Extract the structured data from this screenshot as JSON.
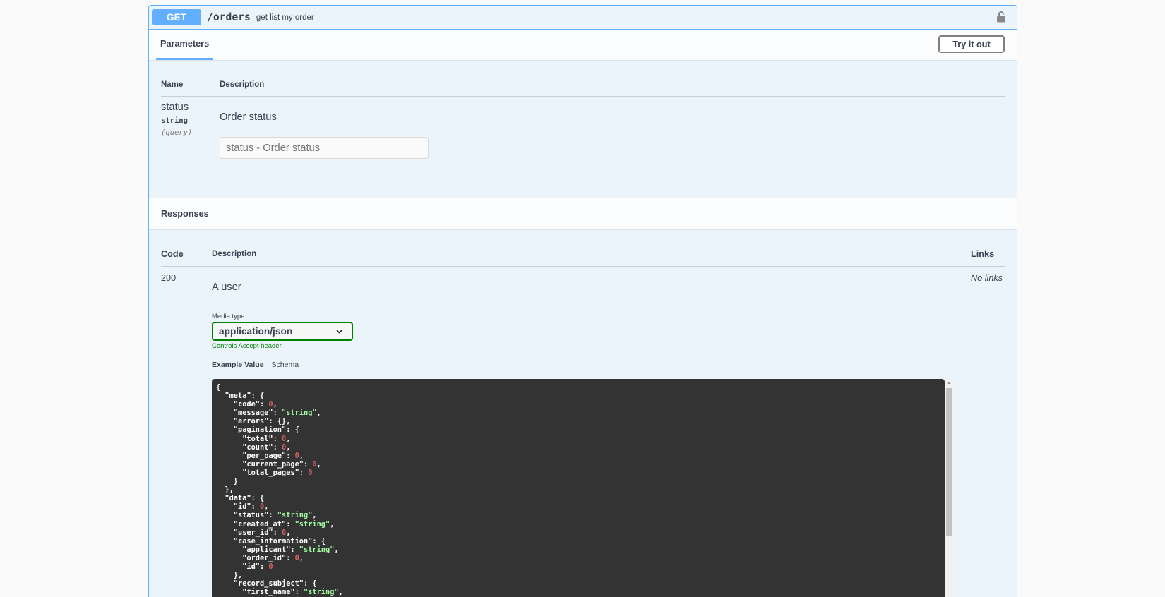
{
  "operation": {
    "method": "GET",
    "path": "/orders",
    "summary": "get list my order",
    "lock_icon": "unlocked-padlock-icon"
  },
  "parameters": {
    "tab_label": "Parameters",
    "try_label": "Try it out",
    "headers": {
      "name": "Name",
      "description": "Description"
    },
    "items": [
      {
        "name": "status",
        "type": "string",
        "in": "(query)",
        "description": "Order status",
        "placeholder": "status - Order status"
      }
    ]
  },
  "responses": {
    "title": "Responses",
    "headers": {
      "code": "Code",
      "description": "Description",
      "links": "Links"
    },
    "items": [
      {
        "code": "200",
        "description": "A user",
        "links": "No links",
        "media_type_label": "Media type",
        "media_type": "application/json",
        "controls_note": "Controls Accept header.",
        "example_tab": "Example Value",
        "schema_tab": "Schema"
      }
    ]
  },
  "example_lines": [
    [
      [
        "k",
        "{"
      ]
    ],
    [
      [
        "k",
        "  \"meta\": {"
      ]
    ],
    [
      [
        "k",
        "    \"code\": "
      ],
      [
        "n",
        "0"
      ],
      [
        "k",
        ","
      ]
    ],
    [
      [
        "k",
        "    \"message\": "
      ],
      [
        "s",
        "\"string\""
      ],
      [
        "k",
        ","
      ]
    ],
    [
      [
        "k",
        "    \"errors\": {},"
      ]
    ],
    [
      [
        "k",
        "    \"pagination\": {"
      ]
    ],
    [
      [
        "k",
        "      \"total\": "
      ],
      [
        "n",
        "0"
      ],
      [
        "k",
        ","
      ]
    ],
    [
      [
        "k",
        "      \"count\": "
      ],
      [
        "n",
        "0"
      ],
      [
        "k",
        ","
      ]
    ],
    [
      [
        "k",
        "      \"per_page\": "
      ],
      [
        "n",
        "0"
      ],
      [
        "k",
        ","
      ]
    ],
    [
      [
        "k",
        "      \"current_page\": "
      ],
      [
        "n",
        "0"
      ],
      [
        "k",
        ","
      ]
    ],
    [
      [
        "k",
        "      \"total_pages\": "
      ],
      [
        "n",
        "0"
      ]
    ],
    [
      [
        "k",
        "    }"
      ]
    ],
    [
      [
        "k",
        "  },"
      ]
    ],
    [
      [
        "k",
        "  \"data\": {"
      ]
    ],
    [
      [
        "k",
        "    \"id\": "
      ],
      [
        "n",
        "0"
      ],
      [
        "k",
        ","
      ]
    ],
    [
      [
        "k",
        "    \"status\": "
      ],
      [
        "s",
        "\"string\""
      ],
      [
        "k",
        ","
      ]
    ],
    [
      [
        "k",
        "    \"created_at\": "
      ],
      [
        "s",
        "\"string\""
      ],
      [
        "k",
        ","
      ]
    ],
    [
      [
        "k",
        "    \"user_id\": "
      ],
      [
        "n",
        "0"
      ],
      [
        "k",
        ","
      ]
    ],
    [
      [
        "k",
        "    \"case_information\": {"
      ]
    ],
    [
      [
        "k",
        "      \"applicant\": "
      ],
      [
        "s",
        "\"string\""
      ],
      [
        "k",
        ","
      ]
    ],
    [
      [
        "k",
        "      \"order_id\": "
      ],
      [
        "n",
        "0"
      ],
      [
        "k",
        ","
      ]
    ],
    [
      [
        "k",
        "      \"id\": "
      ],
      [
        "n",
        "0"
      ]
    ],
    [
      [
        "k",
        "    },"
      ]
    ],
    [
      [
        "k",
        "    \"record_subject\": {"
      ]
    ],
    [
      [
        "k",
        "      \"first_name\": "
      ],
      [
        "s",
        "\"string\""
      ],
      [
        "k",
        ","
      ]
    ]
  ]
}
